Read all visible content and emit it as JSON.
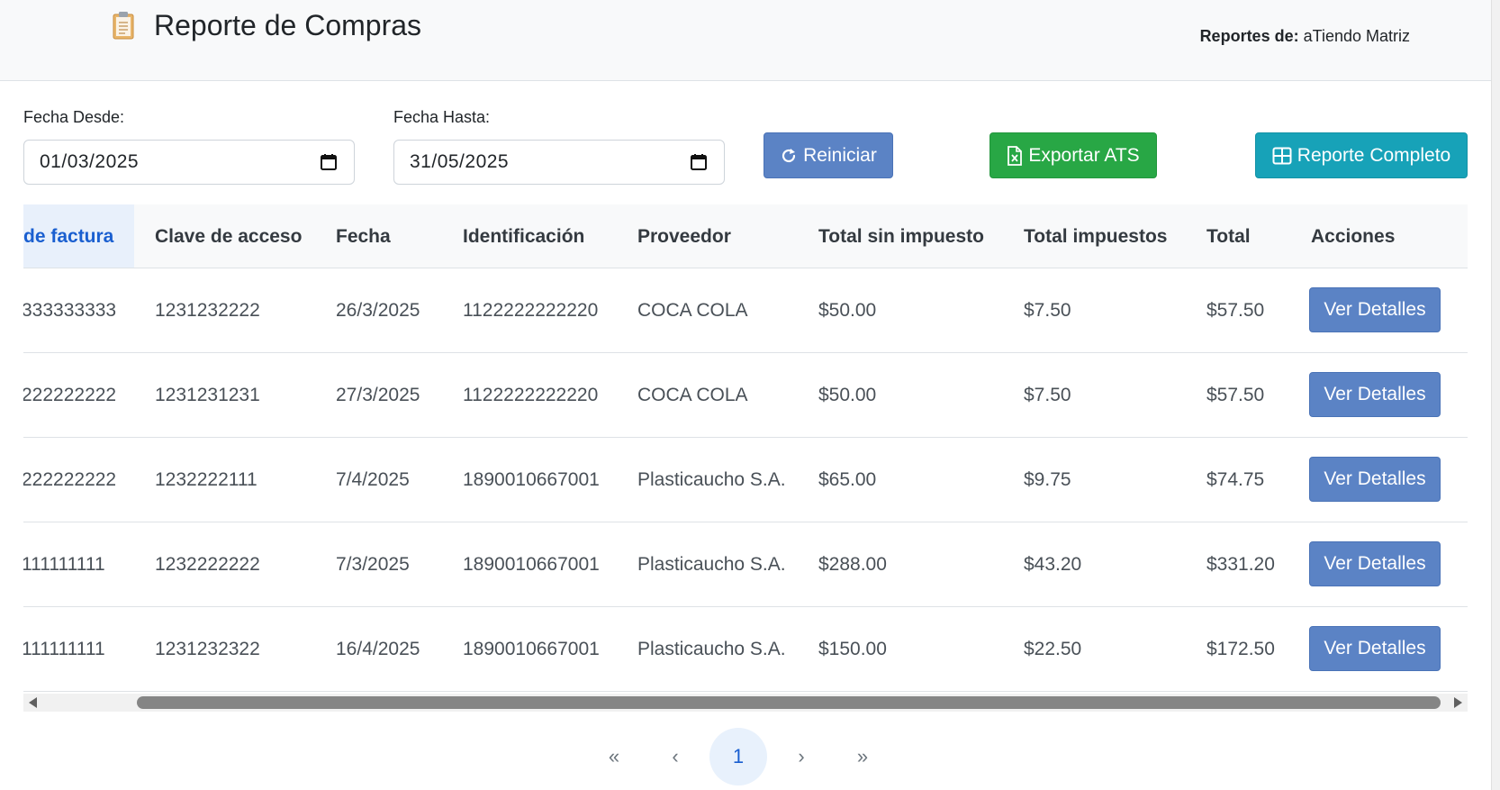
{
  "header": {
    "icon": "clipboard-icon",
    "title": "Reporte de Compras",
    "reports_for_label": "Reportes de:",
    "reports_for_value": "aTiendo Matriz"
  },
  "filters": {
    "from_label": "Fecha Desde:",
    "from_value": "01/03/2025",
    "to_label": "Fecha Hasta:",
    "to_value": "31/05/2025"
  },
  "actions": {
    "reset_label": "Reiniciar",
    "export_label": "Exportar ATS",
    "full_report_label": "Reporte Completo"
  },
  "colors": {
    "reset": "#5b83c5",
    "export": "#28a745",
    "full_report": "#17a2b8",
    "detail": "#5b83c5"
  },
  "table": {
    "columns": [
      "de factura",
      "Clave de acceso",
      "Fecha",
      "Identificación",
      "Proveedor",
      "Total sin impuesto",
      "Total impuestos",
      "Total",
      "Acciones"
    ],
    "rows": [
      {
        "invoice": "333333333",
        "key": "1231232222",
        "date": "26/3/2025",
        "id": "1122222222220",
        "supplier": "COCA COLA",
        "subtotal": "$50.00",
        "taxes": "$7.50",
        "total": "$57.50",
        "action": "Ver Detalles"
      },
      {
        "invoice": "222222222",
        "key": "1231231231",
        "date": "27/3/2025",
        "id": "1122222222220",
        "supplier": "COCA COLA",
        "subtotal": "$50.00",
        "taxes": "$7.50",
        "total": "$57.50",
        "action": "Ver Detalles"
      },
      {
        "invoice": "222222222",
        "key": "1232222111",
        "date": "7/4/2025",
        "id": "1890010667001",
        "supplier": "Plasticaucho S.A.",
        "subtotal": "$65.00",
        "taxes": "$9.75",
        "total": "$74.75",
        "action": "Ver Detalles"
      },
      {
        "invoice": "111111111",
        "key": "1232222222",
        "date": "7/3/2025",
        "id": "1890010667001",
        "supplier": "Plasticaucho S.A.",
        "subtotal": "$288.00",
        "taxes": "$43.20",
        "total": "$331.20",
        "action": "Ver Detalles"
      },
      {
        "invoice": "111111111",
        "key": "1231232322",
        "date": "16/4/2025",
        "id": "1890010667001",
        "supplier": "Plasticaucho S.A.",
        "subtotal": "$150.00",
        "taxes": "$22.50",
        "total": "$172.50",
        "action": "Ver Detalles"
      }
    ]
  },
  "pagination": {
    "first": "«",
    "prev": "‹",
    "current": "1",
    "next": "›",
    "last": "»"
  }
}
